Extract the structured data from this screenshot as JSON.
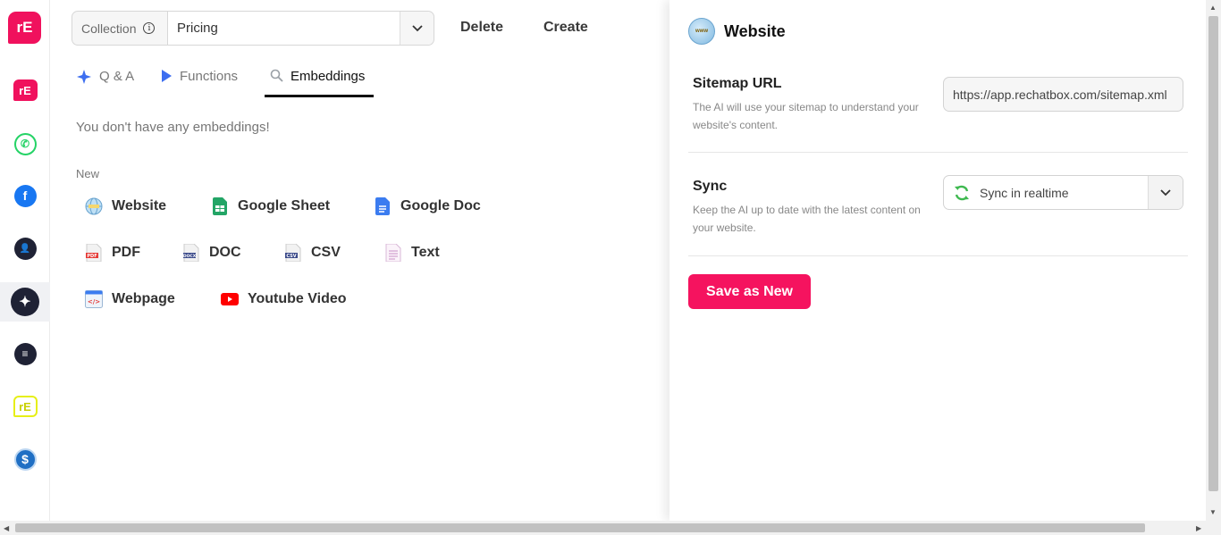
{
  "sidebar": {
    "logo_text": "rE",
    "items": [
      {
        "name": "rechatbox",
        "glyph": "rE"
      },
      {
        "name": "whatsapp",
        "glyph": "✆"
      },
      {
        "name": "facebook",
        "glyph": "f"
      },
      {
        "name": "contacts",
        "glyph": "👤"
      },
      {
        "name": "ai",
        "glyph": "✦"
      },
      {
        "name": "documents",
        "glyph": "≡"
      },
      {
        "name": "rechatbox-yellow",
        "glyph": "rE"
      },
      {
        "name": "billing",
        "glyph": "$"
      }
    ]
  },
  "toolbar": {
    "collection_label": "Collection",
    "collection_value": "Pricing",
    "delete_label": "Delete",
    "create_label": "Create"
  },
  "tabs": [
    {
      "label": "Q & A",
      "icon": "sparkle-icon"
    },
    {
      "label": "Functions",
      "icon": "play-icon"
    },
    {
      "label": "Embeddings",
      "icon": "search-icon",
      "active": true
    }
  ],
  "main": {
    "empty_message": "You don't have any embeddings!",
    "new_label": "New",
    "sources": [
      {
        "label": "Website"
      },
      {
        "label": "Google Sheet"
      },
      {
        "label": "Google Doc"
      },
      {
        "label": "PDF"
      },
      {
        "label": "DOC"
      },
      {
        "label": "CSV"
      },
      {
        "label": "Text"
      },
      {
        "label": "Webpage"
      },
      {
        "label": "Youtube Video"
      }
    ]
  },
  "panel": {
    "title": "Website",
    "sitemap_title": "Sitemap URL",
    "sitemap_desc": "The AI will use your sitemap to understand your website's content.",
    "sitemap_value": "https://app.rechatbox.com/sitemap.xml",
    "sync_title": "Sync",
    "sync_desc": "Keep the AI up to date with the latest content on your website.",
    "sync_value": "Sync in realtime",
    "save_label": "Save as New"
  },
  "colors": {
    "brand": "#f5135f",
    "active_tab_underline": "#111111"
  }
}
